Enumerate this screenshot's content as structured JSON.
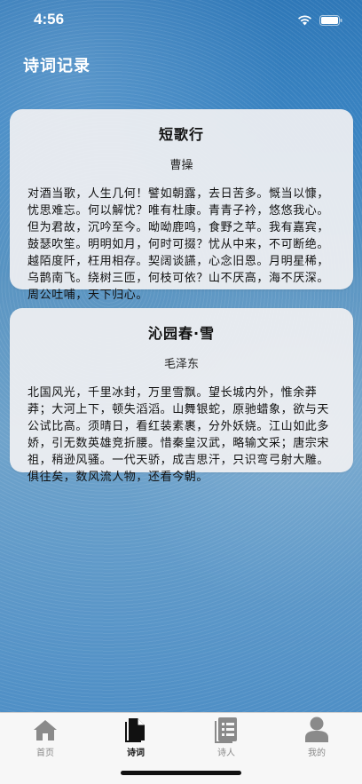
{
  "status_bar": {
    "time": "4:56"
  },
  "nav": {
    "title": "诗词记录"
  },
  "poems": [
    {
      "title": "短歌行",
      "author": "曹操",
      "content": "对酒当歌，人生几何！譬如朝露，去日苦多。慨当以慷，忧思难忘。何以解忧？唯有杜康。青青子衿，悠悠我心。但为君故，沉吟至今。呦呦鹿鸣，食野之苹。我有嘉宾，鼓瑟吹笙。明明如月，何时可掇？忧从中来，不可断绝。越陌度阡，枉用相存。契阔谈讌，心念旧恩。月明星稀，乌鹊南飞。绕树三匝，何枝可依？山不厌高，海不厌深。周公吐哺，天下归心。"
    },
    {
      "title": "沁园春·雪",
      "author": "毛泽东",
      "content": "北国风光，千里冰封，万里雪飘。望长城内外，惟余莽莽；大河上下，顿失滔滔。山舞银蛇，原驰蜡象，欲与天公试比高。须晴日，看红装素裹，分外妖娆。江山如此多娇，引无数英雄竞折腰。惜秦皇汉武，略输文采；唐宗宋祖，稍逊风骚。一代天骄，成吉思汗，只识弯弓射大雕。俱往矣，数风流人物，还看今朝。"
    }
  ],
  "tab_bar": {
    "tabs": [
      {
        "label": "首页",
        "icon": "home-icon",
        "active": false
      },
      {
        "label": "诗词",
        "icon": "document-icon",
        "active": true
      },
      {
        "label": "诗人",
        "icon": "list-document-icon",
        "active": false
      },
      {
        "label": "我的",
        "icon": "person-icon",
        "active": false
      }
    ]
  },
  "colors": {
    "background": "#4f8fc6",
    "card": "#f0f0f2",
    "tab_active": "#111111",
    "tab_inactive": "#8a8a8a"
  }
}
